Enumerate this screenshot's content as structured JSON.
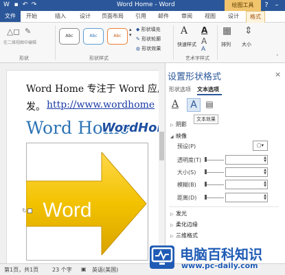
{
  "titlebar": {
    "title": "Word Home - Word",
    "context_group": "绘图工具",
    "help": "?"
  },
  "tabs": [
    {
      "label": "文件"
    },
    {
      "label": "开始"
    },
    {
      "label": "插入"
    },
    {
      "label": "设计"
    },
    {
      "label": "页面布局"
    },
    {
      "label": "引用"
    },
    {
      "label": "邮件"
    },
    {
      "label": "审阅"
    },
    {
      "label": "视图"
    },
    {
      "label": "设计"
    },
    {
      "label": "格式"
    }
  ],
  "ribbon": {
    "edit_shape_label": "在二维视图中编辑",
    "group_shapes": "形状",
    "style_sample": "Abc",
    "group_shape_styles": "形状样式",
    "fill_label": "形状填充",
    "outline_label": "形状轮廓",
    "effects_label": "形状效果",
    "quick_styles_label": "快速样式",
    "group_wordart": "艺术字样式",
    "arrange_label": "排列",
    "size_label": "大小",
    "text_a": "A"
  },
  "document": {
    "line1": "Word Home 专注于 Word 应用",
    "line2_prefix": "发。",
    "line2_link": "http://www.wordhome",
    "heading": "Word Home",
    "watermark": "WordHome",
    "shape_text": "Word"
  },
  "pane": {
    "title": "设置形状格式",
    "close": "×",
    "tab_shape": "形状选项",
    "tab_text": "文本选项",
    "tooltip": "文本效果",
    "sections": {
      "shadow": "阴影",
      "reflection": "映像",
      "glow": "发光",
      "soft_edges": "柔化边缘",
      "3d_format": "三维格式"
    },
    "rows": {
      "preset": "预设(P)",
      "transparency": "透明度(T)",
      "size": "大小(S)",
      "blur": "模糊(B)",
      "distance": "距离(D)"
    }
  },
  "status": {
    "page": "第1页，共1页",
    "words": "23 个字",
    "language": "英语(美国)"
  },
  "logo": {
    "name": "电脑百科知识",
    "url": "www.pc-daily.com"
  },
  "colors": {
    "accent": "#2b579a",
    "arrow_fill": "#f2c200",
    "context_tab": "#f0c36d"
  }
}
